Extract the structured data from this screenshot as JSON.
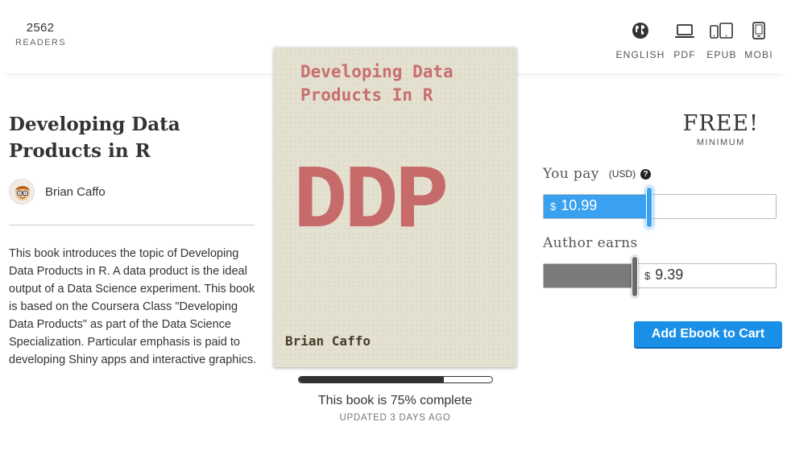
{
  "header": {
    "readers_count": "2562",
    "readers_label": "READERS",
    "formats": [
      {
        "label": "ENGLISH",
        "icon": "globe-icon"
      },
      {
        "label": "PDF",
        "icon": "laptop-icon"
      },
      {
        "label": "EPUB",
        "icon": "tablets-icon"
      },
      {
        "label": "MOBI",
        "icon": "ereader-icon"
      }
    ]
  },
  "book": {
    "title": "Developing Data Products in R",
    "author": "Brian Caffo",
    "description": "This book introduces the topic of Developing Data Products in R. A data product is the ideal output of a Data Science experiment. This book is based on the Coursera Class \"Developing Data Products\" as part of the Data Science Specialization. Particular emphasis is paid to developing Shiny apps and interactive graphics."
  },
  "cover": {
    "title": "Developing Data Products In R",
    "acronym": "DDP",
    "author": "Brian Caffo"
  },
  "progress": {
    "percent": 75,
    "complete_text": "This book is 75% complete",
    "updated_text": "UPDATED 3 DAYS AGO"
  },
  "pricing": {
    "price_label": "FREE!",
    "minimum_label": "MINIMUM",
    "you_pay_label": "You pay",
    "currency_label": "(USD)",
    "help_symbol": "?",
    "currency_symbol": "$",
    "you_pay_value": "10.99",
    "you_pay_fraction": 0.45,
    "author_earns_label": "Author earns",
    "author_earns_value": "9.39",
    "author_earns_fraction": 0.39,
    "add_to_cart_label": "Add Ebook to Cart",
    "accent_color": "#1a8fe8"
  }
}
